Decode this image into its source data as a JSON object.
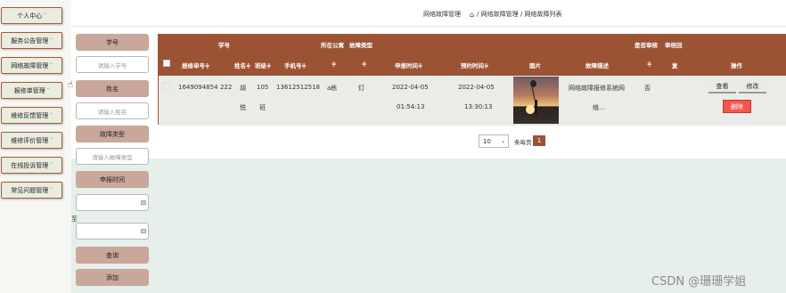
{
  "sidebar": {
    "items": [
      {
        "label": "个人中心",
        "caret": "˅"
      },
      {
        "label": "服务公告管理",
        "caret": "˅"
      },
      {
        "label": "网络故障管理",
        "caret": "˅"
      },
      {
        "label": "报修单管理",
        "caret": "˅"
      },
      {
        "label": "维修反馈管理",
        "caret": "˅"
      },
      {
        "label": "维修评价管理",
        "caret": "˅"
      },
      {
        "label": "在线投诉管理",
        "caret": "˅"
      },
      {
        "label": "常见问题管理",
        "caret": "˅"
      }
    ]
  },
  "header": {
    "title": "网络故障管理",
    "breadcrumb": "/ 网络故障管理 / 网络故障列表"
  },
  "search": {
    "student_id_label": "学号",
    "student_id_placeholder": "请输入学号",
    "name_label": "姓名",
    "name_placeholder": "请输入姓名",
    "fault_type_label": "故障类型",
    "fault_type_placeholder": "请输入故障类型",
    "report_time_label": "申报时间",
    "range_to": "至",
    "query_button": "查询",
    "add_button": "添加"
  },
  "table": {
    "top_headers": {
      "student_id": "学号",
      "dorm": "所在公寓",
      "fault_type": "故障类型",
      "is_reviewed": "是否审核",
      "review_reply": "审核回"
    },
    "headers": {
      "report_no": "报修单号≑",
      "name": "姓名≑",
      "class": "班级≑",
      "phone": "手机号≑",
      "dorm_sort": "≑",
      "fault_sort": "≑",
      "report_time": "申报时间≑",
      "appt_time": "预约时间≑",
      "image": "图片",
      "fault_desc": "故障描述",
      "desc_sort": "≑",
      "reply": "复",
      "actions": "操作"
    },
    "rows": [
      {
        "report_no": "1649094854",
        "student_id": "222",
        "name_line1": "胡",
        "name_line2": "悦",
        "class_line1": "105",
        "class_line2": "班",
        "phone": "13612512518",
        "dorm": "a栋",
        "fault_type": "灯",
        "report_date": "2022-04-05",
        "report_clock": "01:54:13",
        "appt_date": "2022-04-05",
        "appt_clock": "13:30:13",
        "image_alt": "balloon-girl-sunset",
        "fault_desc_line1": "网络故障报修系统网",
        "fault_desc_line2": "络...",
        "is_reviewed": "否",
        "view_button": "查看",
        "edit_button": "修改",
        "delete_button": "删除"
      }
    ]
  },
  "pagination": {
    "page_size": "10",
    "per_page_text": "条每页",
    "current_page": "1"
  },
  "watermark": "CSDN @珊珊学姐",
  "colors": {
    "brand": "#9c5334",
    "button_tan": "#c9a79a",
    "delete_red": "#f2574e",
    "content_green": "#e6efea"
  }
}
